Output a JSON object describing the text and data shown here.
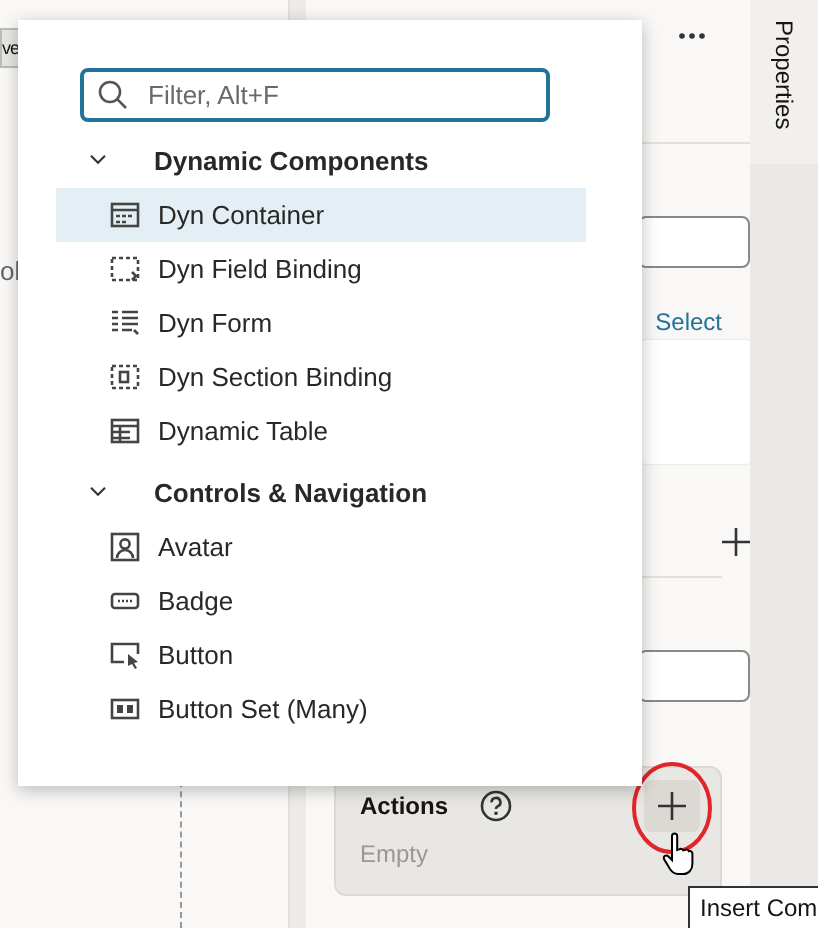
{
  "left_panel": {
    "tab_fragment": "ve",
    "text_fragment": "ol"
  },
  "menu": {
    "search": {
      "placeholder": "Filter, Alt+F"
    },
    "groups": [
      {
        "label": "Dynamic Components",
        "expanded": true,
        "items": [
          {
            "label": "Dyn Container",
            "selected": true
          },
          {
            "label": "Dyn Field Binding",
            "selected": false
          },
          {
            "label": "Dyn Form",
            "selected": false
          },
          {
            "label": "Dyn Section Binding",
            "selected": false
          },
          {
            "label": "Dynamic Table",
            "selected": false
          }
        ]
      },
      {
        "label": "Controls & Navigation",
        "expanded": true,
        "items": [
          {
            "label": "Avatar",
            "selected": false
          },
          {
            "label": "Badge",
            "selected": false
          },
          {
            "label": "Button",
            "selected": false
          },
          {
            "label": "Button Set (Many)",
            "selected": false
          }
        ]
      }
    ]
  },
  "properties_panel": {
    "select_link": "Select",
    "actions": {
      "label": "Actions",
      "value": "Empty"
    }
  },
  "side_tab": {
    "label": "Properties"
  },
  "tooltip": "Insert Com"
}
